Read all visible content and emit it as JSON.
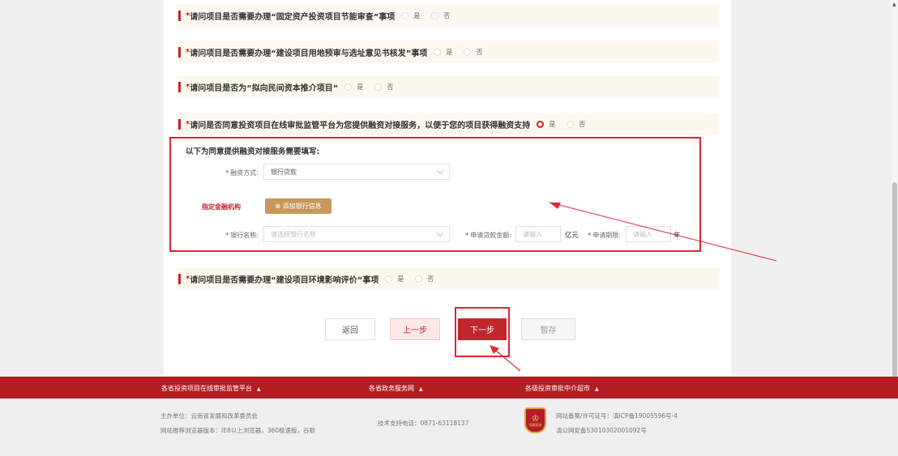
{
  "questions": [
    {
      "text": "请问项目是否需要办理“固定资产投资项目节能审查”事项",
      "opt_yes": "是",
      "opt_no": "否"
    },
    {
      "text": "请问项目是否需要办理“建设项目用地预审与选址意见书核发”事项",
      "opt_yes": "是",
      "opt_no": "否"
    },
    {
      "text": "请问项目是否为“拟向民间资本推介项目”",
      "opt_yes": "是",
      "opt_no": "否"
    },
    {
      "text": "请问是否同意投资项目在线审批监管平台为您提供融资对接服务，以便于您的项目获得融资支持",
      "opt_yes": "是",
      "opt_no": "否",
      "selected": "是"
    },
    {
      "text": "请问项目是否需要办理“建设项目环境影响评价”事项",
      "opt_yes": "是",
      "opt_no": "否"
    }
  ],
  "required_mark": "*",
  "financing": {
    "title": "以下为同意提供融资对接服务需要填写:",
    "method_label": "融资方式:",
    "method_value": "银行贷款",
    "org_label": "指定金融机构",
    "add_bank": "⊕ 添加银行信息",
    "bank_label": "银行名称:",
    "bank_placeholder": "请选择银行名称",
    "amount_label": "申请贷款金额:",
    "amount_placeholder": "请输入",
    "amount_unit": "亿元",
    "period_label": "申请期限:",
    "period_placeholder": "请输入",
    "period_unit": "年"
  },
  "buttons": {
    "back": "返回",
    "prev": "上一步",
    "next": "下一步",
    "save": "暂存"
  },
  "footer": {
    "links": [
      {
        "label": "各省投资项目在线审批监管平台",
        "arrow": "▲"
      },
      {
        "label": "各省政务服务网",
        "arrow": "▲"
      },
      {
        "label": "各级投资审批中介超市",
        "arrow": "▲"
      }
    ],
    "host": "主办单位：云南省发展和改革委员会",
    "browser": "网站推荐浏览器版本：IE8以上浏览器，360极速版，谷歌",
    "tech": "技术支持电话：0871-63118137",
    "icp": "网站备案/许可证号：滇ICP备19005596号-4",
    "police": "滇公网安备53010302001092号",
    "badge_text": "党政机关"
  },
  "colors": {
    "accent": "#c0272d",
    "annotation": "#e0262e",
    "gold": "#c8985a"
  }
}
